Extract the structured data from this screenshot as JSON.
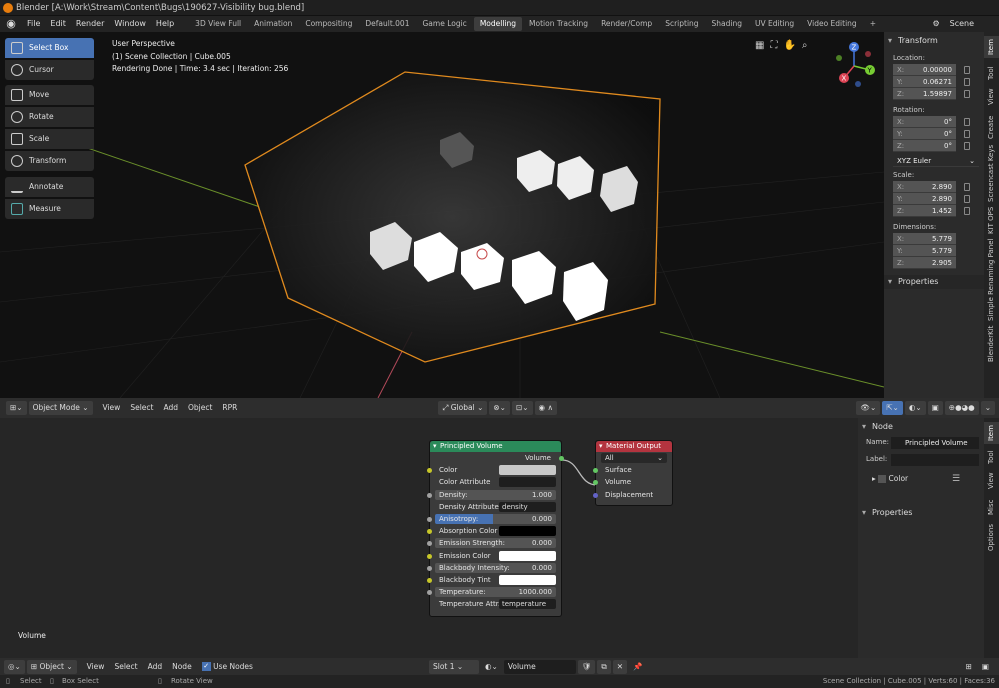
{
  "window": {
    "title": "Blender [A:\\Work\\Stream\\Content\\Bugs\\190627-Visibility bug.blend]"
  },
  "menu": [
    "File",
    "Edit",
    "Render",
    "Window",
    "Help"
  ],
  "workspaces": [
    "3D View Full",
    "Animation",
    "Compositing",
    "Default.001",
    "Game Logic",
    "Modelling",
    "Motion Tracking",
    "Render/Comp",
    "Scripting",
    "Shading",
    "UV Editing",
    "Video Editing"
  ],
  "active_workspace": "Modelling",
  "scene": "Scene",
  "viewport": {
    "info": [
      "User Perspective",
      "(1) Scene Collection | Cube.005",
      "Rendering Done | Time: 3.4 sec | Iteration: 256"
    ],
    "tools": [
      "Select Box",
      "Cursor",
      "Move",
      "Rotate",
      "Scale",
      "Transform",
      "Annotate",
      "Measure"
    ],
    "gizmo": {
      "x": "X",
      "y": "Y",
      "z": "Z"
    }
  },
  "sidebar": {
    "title": "Transform",
    "location_label": "Location:",
    "location": [
      {
        "k": "X:",
        "v": "0.00000"
      },
      {
        "k": "Y:",
        "v": "0.06271"
      },
      {
        "k": "Z:",
        "v": "1.59897"
      }
    ],
    "rotation_label": "Rotation:",
    "rotation": [
      {
        "k": "X:",
        "v": "0°"
      },
      {
        "k": "Y:",
        "v": "0°"
      },
      {
        "k": "Z:",
        "v": "0°"
      }
    ],
    "rotation_mode": "XYZ Euler",
    "scale_label": "Scale:",
    "scale": [
      {
        "k": "X:",
        "v": "2.890"
      },
      {
        "k": "Y:",
        "v": "2.890"
      },
      {
        "k": "Z:",
        "v": "1.452"
      }
    ],
    "dimensions_label": "Dimensions:",
    "dimensions": [
      {
        "k": "X:",
        "v": "5.779"
      },
      {
        "k": "Y:",
        "v": "5.779"
      },
      {
        "k": "Z:",
        "v": "2.905"
      }
    ],
    "properties": "Properties",
    "tabs": [
      "Item",
      "Tool",
      "View",
      "Create",
      "Screencast Keys",
      "KIT OPS",
      "Simple Renaming Panel",
      "BlenderKit"
    ]
  },
  "view_header": {
    "mode": "Object Mode",
    "menus": [
      "View",
      "Select",
      "Add",
      "Object",
      "RPR"
    ],
    "orientation": "Global"
  },
  "nodes": {
    "principled": {
      "title": "Principled Volume",
      "output": "Volume",
      "rows": [
        {
          "label": "Color",
          "type": "color",
          "color": "#c8c8c8"
        },
        {
          "label": "Color Attribute",
          "type": "text",
          "value": ""
        },
        {
          "label": "Density:",
          "type": "slider",
          "value": "1.000"
        },
        {
          "label": "Density Attribute",
          "type": "text",
          "value": "density"
        },
        {
          "label": "Anisotropy:",
          "type": "slider",
          "value": "0.000",
          "active": true
        },
        {
          "label": "Absorption Color",
          "type": "color",
          "color": "#000000"
        },
        {
          "label": "Emission Strength:",
          "type": "slider",
          "value": "0.000"
        },
        {
          "label": "Emission Color",
          "type": "color",
          "color": "#ffffff"
        },
        {
          "label": "Blackbody Intensity:",
          "type": "slider",
          "value": "0.000"
        },
        {
          "label": "Blackbody Tint",
          "type": "color",
          "color": "#ffffff"
        },
        {
          "label": "Temperature:",
          "type": "slider",
          "value": "1000.000"
        },
        {
          "label": "Temperature Attr...",
          "type": "text",
          "value": "temperature"
        }
      ]
    },
    "output": {
      "title": "Material Output",
      "target": "All",
      "inputs": [
        "Surface",
        "Volume",
        "Displacement"
      ]
    }
  },
  "node_panel": {
    "title": "Node",
    "name_label": "Name:",
    "name": "Principled Volume",
    "label_label": "Label:",
    "label": "",
    "color": "Color",
    "properties": "Properties",
    "tabs": [
      "Item",
      "Tool",
      "View",
      "Misc",
      "Options"
    ]
  },
  "node_editor": {
    "label": "Volume"
  },
  "node_header": {
    "editor": "Object",
    "menus": [
      "View",
      "Select",
      "Add",
      "Node"
    ],
    "use_nodes": "Use Nodes",
    "slot": "Slot 1",
    "material": "Volume"
  },
  "status": {
    "select": "Select",
    "box_select": "Box Select",
    "rotate_view": "Rotate View",
    "info": "Scene Collection | Cube.005 | Verts:60 | Faces:36"
  }
}
